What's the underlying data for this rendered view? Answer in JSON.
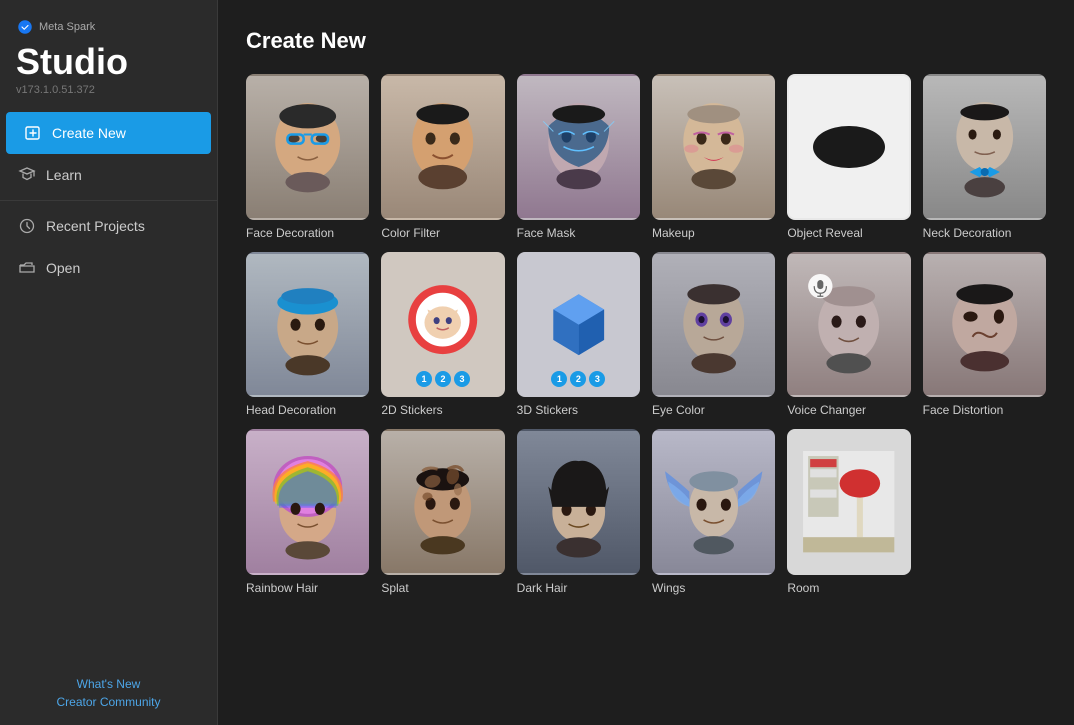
{
  "sidebar": {
    "logo_text": "Meta Spark",
    "title": "Studio",
    "version": "v173.1.0.51.372",
    "nav_items": [
      {
        "id": "create-new",
        "label": "Create New",
        "active": true
      },
      {
        "id": "learn",
        "label": "Learn",
        "active": false
      },
      {
        "id": "recent-projects",
        "label": "Recent Projects",
        "active": false
      },
      {
        "id": "open",
        "label": "Open",
        "active": false
      }
    ],
    "footer_links": [
      {
        "id": "whats-new",
        "label": "What's New"
      },
      {
        "id": "creator-community",
        "label": "Creator Community"
      }
    ]
  },
  "main": {
    "title": "Create New",
    "templates": [
      {
        "id": "face-decoration",
        "label": "Face Decoration",
        "bg_class": "card-face-decoration",
        "row": 1
      },
      {
        "id": "color-filter",
        "label": "Color Filter",
        "bg_class": "card-color-filter",
        "row": 1
      },
      {
        "id": "face-mask",
        "label": "Face Mask",
        "bg_class": "card-face-mask",
        "row": 1
      },
      {
        "id": "makeup",
        "label": "Makeup",
        "bg_class": "card-makeup",
        "row": 1
      },
      {
        "id": "object-reveal",
        "label": "Object Reveal",
        "bg_class": "card-object-reveal",
        "row": 1
      },
      {
        "id": "neck-decoration",
        "label": "Neck Decoration",
        "bg_class": "card-neck-decoration",
        "row": 1
      },
      {
        "id": "head-decoration",
        "label": "Head Decoration",
        "bg_class": "card-head-decoration",
        "row": 2
      },
      {
        "id": "2d-stickers",
        "label": "2D Stickers",
        "bg_class": "card-2d-stickers",
        "row": 2
      },
      {
        "id": "3d-stickers",
        "label": "3D Stickers",
        "bg_class": "card-3d-stickers",
        "row": 2
      },
      {
        "id": "eye-color",
        "label": "Eye Color",
        "bg_class": "card-eye-color",
        "row": 2
      },
      {
        "id": "voice-changer",
        "label": "Voice Changer",
        "bg_class": "card-voice-changer",
        "row": 2
      },
      {
        "id": "face-distortion",
        "label": "Face Distortion",
        "bg_class": "card-face-distortion",
        "row": 2
      },
      {
        "id": "rainbow-hair",
        "label": "Rainbow Hair",
        "bg_class": "card-rainbow",
        "row": 3
      },
      {
        "id": "splat",
        "label": "Splat",
        "bg_class": "card-splat",
        "row": 3
      },
      {
        "id": "dark-hair",
        "label": "Dark Hair",
        "bg_class": "card-dark-hair",
        "row": 3
      },
      {
        "id": "wings",
        "label": "Wings",
        "bg_class": "card-wings",
        "row": 3
      },
      {
        "id": "room",
        "label": "Room",
        "bg_class": "card-room",
        "row": 3
      }
    ],
    "sticker_badges": [
      "1",
      "2",
      "3"
    ]
  }
}
